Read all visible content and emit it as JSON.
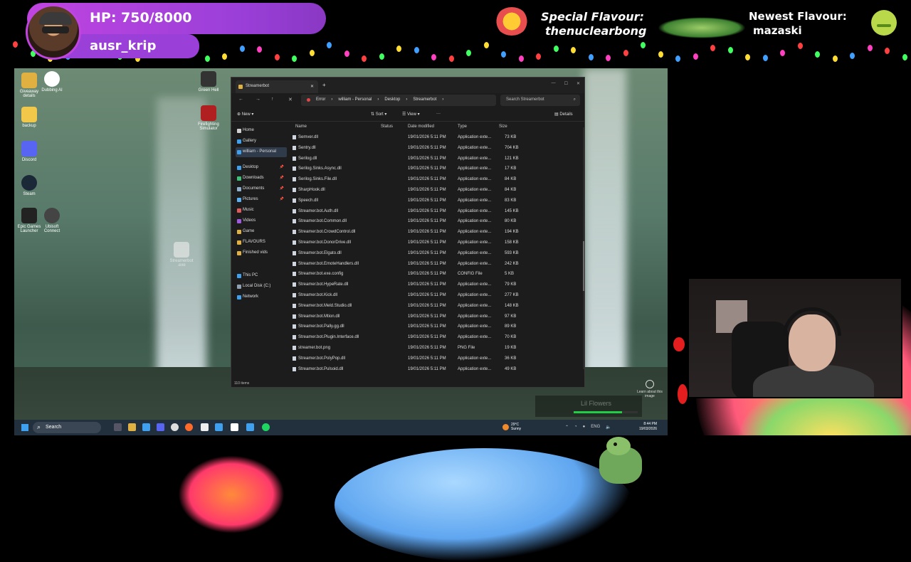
{
  "overlay": {
    "hp": "HP: 750/8000",
    "username": "ausr_krip",
    "special_label": "Special Flavour:",
    "special_name": "thenuclearbong",
    "newest_label": "Newest Flavour:",
    "newest_name": "mazaski",
    "progress_text": "Lil Flowers",
    "progress_fraction": 0.75,
    "learn_text": "Learn about this image"
  },
  "desktop_icons": [
    {
      "label": "Giveaway details",
      "color": "#e0b040"
    },
    {
      "label": "Dubbing AI",
      "color": "#ffffff"
    },
    {
      "label": "backup",
      "color": "#f2c84a"
    },
    {
      "label": "Discord",
      "color": "#5865f2"
    },
    {
      "label": "Steam",
      "color": "#1b2838"
    },
    {
      "label": "Epic Games Launcher",
      "color": "#222222"
    },
    {
      "label": "Ubisoft Connect",
      "color": "#444444"
    },
    {
      "label": "Green Hell",
      "color": "#333333"
    },
    {
      "label": "Firefighting Simulator",
      "color": "#b02020"
    },
    {
      "label": "Streamerbot .exe",
      "color": "#eeeeee"
    }
  ],
  "explorer": {
    "tab_title": "Streamerbot",
    "breadcrumb": [
      "Error",
      "william - Personal",
      "Desktop",
      "Streamerbot"
    ],
    "search_placeholder": "Search Streamerbot",
    "cmd": {
      "new": "New",
      "sort": "Sort",
      "view": "View",
      "more": "···",
      "details": "Details"
    },
    "nav": [
      {
        "label": "Home",
        "color": "#d0d0d0"
      },
      {
        "label": "Gallery",
        "color": "#3fa0f0"
      },
      {
        "label": "william - Personal",
        "color": "#3fa0f0"
      },
      {
        "label": "Desktop",
        "color": "#3fa0f0"
      },
      {
        "label": "Downloads",
        "color": "#3fc07a"
      },
      {
        "label": "Documents",
        "color": "#90b0d0"
      },
      {
        "label": "Pictures",
        "color": "#5ab0f0"
      },
      {
        "label": "Music",
        "color": "#e05a5a"
      },
      {
        "label": "Videos",
        "color": "#a05ae0"
      },
      {
        "label": "Game",
        "color": "#e0b040"
      },
      {
        "label": "FLAVOURS",
        "color": "#e0b040"
      },
      {
        "label": "Finished vids",
        "color": "#e0b040"
      },
      {
        "label": "This PC",
        "color": "#3fa0f0"
      },
      {
        "label": "Local Disk (C:)",
        "color": "#90a0b0"
      },
      {
        "label": "Network",
        "color": "#3fa0f0"
      }
    ],
    "columns": {
      "name": "Name",
      "status": "Status",
      "date": "Date modified",
      "type": "Type",
      "size": "Size"
    },
    "rows": [
      {
        "name": "Semver.dll",
        "date": "19/01/2026 5:11 PM",
        "type": "Application exte...",
        "size": "73 KB"
      },
      {
        "name": "Sentry.dll",
        "date": "19/01/2026 5:11 PM",
        "type": "Application exte...",
        "size": "704 KB"
      },
      {
        "name": "Serilog.dll",
        "date": "19/01/2026 5:11 PM",
        "type": "Application exte...",
        "size": "121 KB"
      },
      {
        "name": "Serilog.Sinks.Async.dll",
        "date": "19/01/2026 5:11 PM",
        "type": "Application exte...",
        "size": "17 KB"
      },
      {
        "name": "Serilog.Sinks.File.dll",
        "date": "19/01/2026 5:11 PM",
        "type": "Application exte...",
        "size": "84 KB"
      },
      {
        "name": "SharpHook.dll",
        "date": "19/01/2026 5:11 PM",
        "type": "Application exte...",
        "size": "84 KB"
      },
      {
        "name": "Speech.dll",
        "date": "19/01/2026 5:11 PM",
        "type": "Application exte...",
        "size": "83 KB"
      },
      {
        "name": "Streamer.bot.Auth.dll",
        "date": "19/01/2026 5:11 PM",
        "type": "Application exte...",
        "size": "145 KB"
      },
      {
        "name": "Streamer.bot.Common.dll",
        "date": "19/01/2026 5:11 PM",
        "type": "Application exte...",
        "size": "80 KB"
      },
      {
        "name": "Streamer.bot.CrowdControl.dll",
        "date": "19/01/2026 5:11 PM",
        "type": "Application exte...",
        "size": "194 KB"
      },
      {
        "name": "Streamer.bot.DonorDrive.dll",
        "date": "19/01/2026 5:11 PM",
        "type": "Application exte...",
        "size": "158 KB"
      },
      {
        "name": "Streamer.bot.Elgato.dll",
        "date": "19/01/2026 5:11 PM",
        "type": "Application exte...",
        "size": "593 KB"
      },
      {
        "name": "Streamer.bot.EmoteHandlers.dll",
        "date": "19/01/2026 5:11 PM",
        "type": "Application exte...",
        "size": "242 KB"
      },
      {
        "name": "Streamer.bot.exe.config",
        "date": "19/01/2026 5:11 PM",
        "type": "CONFIG File",
        "size": "5 KB"
      },
      {
        "name": "Streamer.bot.HypeRate.dll",
        "date": "19/01/2026 5:11 PM",
        "type": "Application exte...",
        "size": "79 KB"
      },
      {
        "name": "Streamer.bot.Kick.dll",
        "date": "19/01/2026 5:11 PM",
        "type": "Application exte...",
        "size": "277 KB"
      },
      {
        "name": "Streamer.bot.Meld.Studio.dll",
        "date": "19/01/2026 5:11 PM",
        "type": "Application exte...",
        "size": "148 KB"
      },
      {
        "name": "Streamer.bot.Mtion.dll",
        "date": "19/01/2026 5:11 PM",
        "type": "Application exte...",
        "size": "97 KB"
      },
      {
        "name": "Streamer.bot.Pally.gg.dll",
        "date": "19/01/2026 5:11 PM",
        "type": "Application exte...",
        "size": "89 KB"
      },
      {
        "name": "Streamer.bot.Plugin.Interface.dll",
        "date": "19/01/2026 5:11 PM",
        "type": "Application exte...",
        "size": "70 KB"
      },
      {
        "name": "streamer.bot.png",
        "date": "19/01/2026 5:11 PM",
        "type": "PNG File",
        "size": "19 KB"
      },
      {
        "name": "Streamer.bot.PolyPop.dll",
        "date": "19/01/2026 5:11 PM",
        "type": "Application exte...",
        "size": "36 KB"
      },
      {
        "name": "Streamer.bot.Pulsoid.dll",
        "date": "19/01/2026 5:11 PM",
        "type": "Application exte...",
        "size": "49 KB"
      }
    ],
    "status": "110 items"
  },
  "taskbar": {
    "search": "Search",
    "weather_temp": "29°C",
    "weather_desc": "Sunny",
    "lang": "ENG",
    "time": "8:44 PM",
    "date": "19/03/2026"
  },
  "colors": {
    "overlay_purple": "#9b3fd9",
    "accent_blue": "#3fa0f0",
    "progress_green": "#22cc44"
  }
}
